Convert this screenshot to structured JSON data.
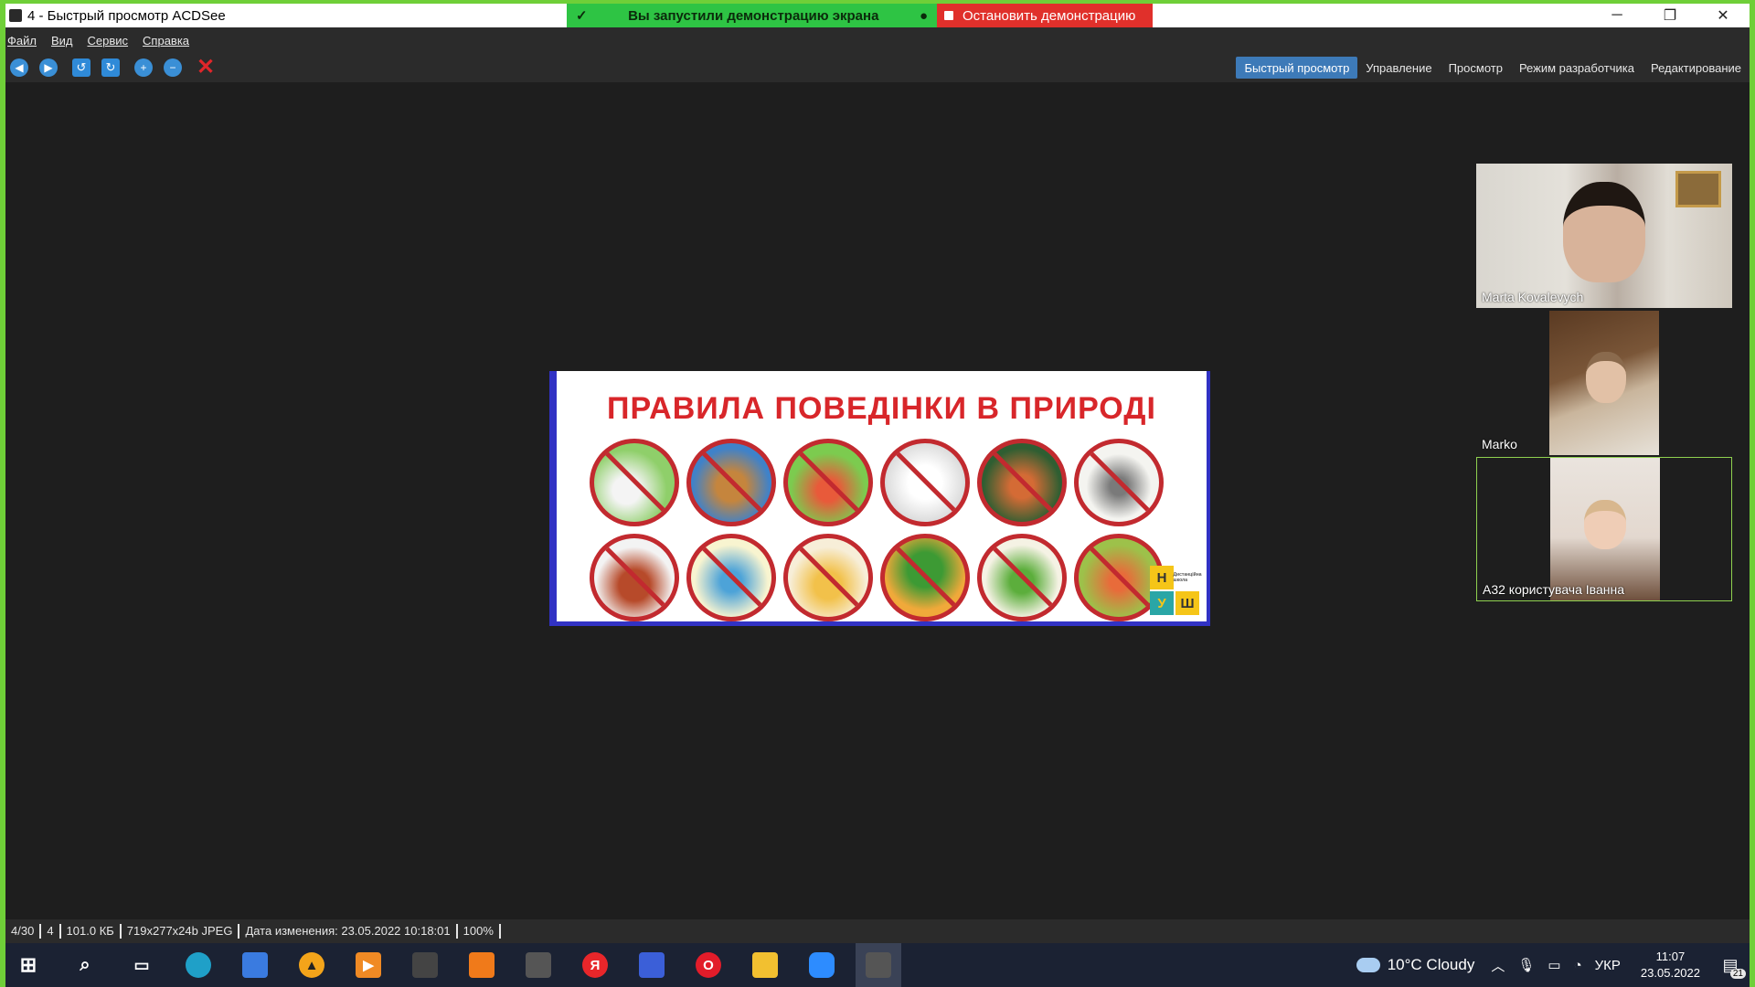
{
  "window": {
    "title": "4 - Быстрый просмотр ACDSee",
    "minimize": "─",
    "restore": "❐",
    "close": "✕"
  },
  "share": {
    "status_text": "Вы запустили демонстрацию экрана",
    "stop_label": "Остановить демонстрацию"
  },
  "menu": {
    "file": "Файл",
    "view": "Вид",
    "service": "Сервис",
    "help": "Справка"
  },
  "toolbar": {
    "icons": [
      "back-icon",
      "forward-icon",
      "rotate-left-icon",
      "rotate-right-icon",
      "zoom-in-icon",
      "zoom-out-icon",
      "delete-icon"
    ],
    "back": "◀",
    "forward": "▶",
    "rotate_left": "↺",
    "rotate_right": "↻",
    "zoom_in": "+",
    "zoom_out": "−",
    "delete": "✕"
  },
  "modes": {
    "quick_view": "Быстрый просмотр",
    "manage": "Управление",
    "view": "Просмотр",
    "developer": "Режим разработчика",
    "edit": "Редактирование",
    "active": "quick_view"
  },
  "image": {
    "title": "ПРАВИЛА ПОВЕДІНКИ В ПРИРОДІ",
    "logo": {
      "n": "Н",
      "u": "У",
      "sh": "Ш",
      "small": "Дистанційна школа"
    }
  },
  "participants": [
    {
      "name": "Marta Kovalevych"
    },
    {
      "name": "Marko"
    },
    {
      "name": "A32 користувача Іванна"
    }
  ],
  "status": {
    "index": "4/30",
    "name": "4",
    "size": "101.0 КБ",
    "dims": "719x277x24b JPEG",
    "modified": "Дата изменения: 23.05.2022 10:18:01",
    "zoom": "100%"
  },
  "taskbar": {
    "apps": [
      "start-icon",
      "search-icon",
      "task-view-icon",
      "edge-icon",
      "store-icon",
      "avast-icon",
      "media-player-icon",
      "video-editor-icon",
      "pdf-icon",
      "camera-icon",
      "yandex-icon",
      "save-icon",
      "opera-icon",
      "file-explorer-icon",
      "zoom-icon",
      "acdsee-icon"
    ],
    "yandex": "Я",
    "opera": "O",
    "weather": "10°C  Cloudy",
    "lang": "УКР",
    "time": "11:07",
    "date": "23.05.2022",
    "notifications": "21"
  }
}
